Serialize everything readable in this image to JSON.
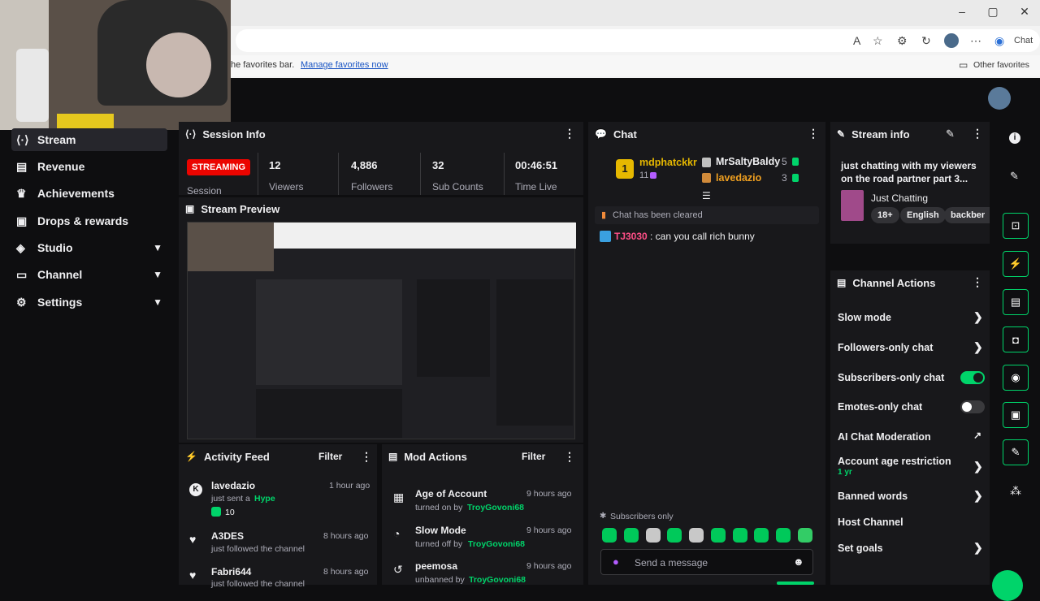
{
  "browser": {
    "favbar_text": "he favorites bar.",
    "favbar_link": "Manage favorites now",
    "other_favorites": "Other favorites",
    "chat_button": "Chat"
  },
  "sidebar": {
    "items": [
      {
        "label": "Stream"
      },
      {
        "label": "Revenue"
      },
      {
        "label": "Achievements"
      },
      {
        "label": "Drops & rewards"
      },
      {
        "label": "Studio"
      },
      {
        "label": "Channel"
      },
      {
        "label": "Settings"
      }
    ]
  },
  "session": {
    "title": "Session Info",
    "status": "STREAMING",
    "session_label": "Session",
    "stats": [
      {
        "value": "12",
        "label": "Viewers"
      },
      {
        "value": "4,886",
        "label": "Followers"
      },
      {
        "value": "32",
        "label": "Sub Counts"
      },
      {
        "value": "00:46:51",
        "label": "Time Live"
      }
    ]
  },
  "preview": {
    "title": "Stream Preview"
  },
  "activity": {
    "title": "Activity Feed",
    "filter": "Filter",
    "items": [
      {
        "name": "lavedazio",
        "line1": "just sent a",
        "highlight": "Hype",
        "amount": "10",
        "time": "1 hour ago"
      },
      {
        "name": "A3DES",
        "line1": "just followed the channel",
        "time": "8 hours ago"
      },
      {
        "name": "Fabri644",
        "line1": "just followed the channel",
        "time": "8 hours ago"
      }
    ]
  },
  "mod": {
    "title": "Mod Actions",
    "filter": "Filter",
    "items": [
      {
        "name": "Age of Account",
        "verb": "turned on by",
        "by": "TroyGovoni68",
        "time": "9 hours ago"
      },
      {
        "name": "Slow Mode",
        "verb": "turned off by",
        "by": "TroyGovoni68",
        "time": "9 hours ago"
      },
      {
        "name": "peemosa",
        "verb": "unbanned by",
        "by": "TroyGovoni68",
        "time": "9 hours ago"
      }
    ]
  },
  "chat": {
    "title": "Chat",
    "leaders": [
      {
        "rank": "1",
        "name": "mdphatckkr",
        "count": "11"
      },
      {
        "rank": "",
        "name": "MrSaltyBaldy",
        "count": "5"
      },
      {
        "rank": "",
        "name": "lavedazio",
        "count": "3"
      }
    ],
    "cleared": "Chat has been cleared",
    "messages": [
      {
        "user": "TJ3030",
        "text": ": can you call rich bunny"
      }
    ],
    "mode": "Subscribers only",
    "placeholder": "Send a message"
  },
  "stream_info": {
    "title": "Stream info",
    "stream_title": "just chatting with my viewers on the road partner part 3...",
    "category": "Just Chatting",
    "tags": [
      "18+",
      "English",
      "backber"
    ]
  },
  "channel_actions": {
    "title": "Channel Actions",
    "items": [
      {
        "label": "Slow mode"
      },
      {
        "label": "Followers-only chat"
      },
      {
        "label": "Subscribers-only chat",
        "toggle": true
      },
      {
        "label": "Emotes-only chat",
        "toggle": false
      },
      {
        "label": "AI Chat Moderation"
      },
      {
        "label": "Account age restriction",
        "sub": "1 yr"
      },
      {
        "label": "Banned words"
      },
      {
        "label": "Host Channel"
      },
      {
        "label": "Set goals"
      }
    ]
  },
  "colors": {
    "accent": "#00d46a",
    "streaming": "#eb0400",
    "panel": "#18181b",
    "chat_user": "#ff4f87"
  }
}
